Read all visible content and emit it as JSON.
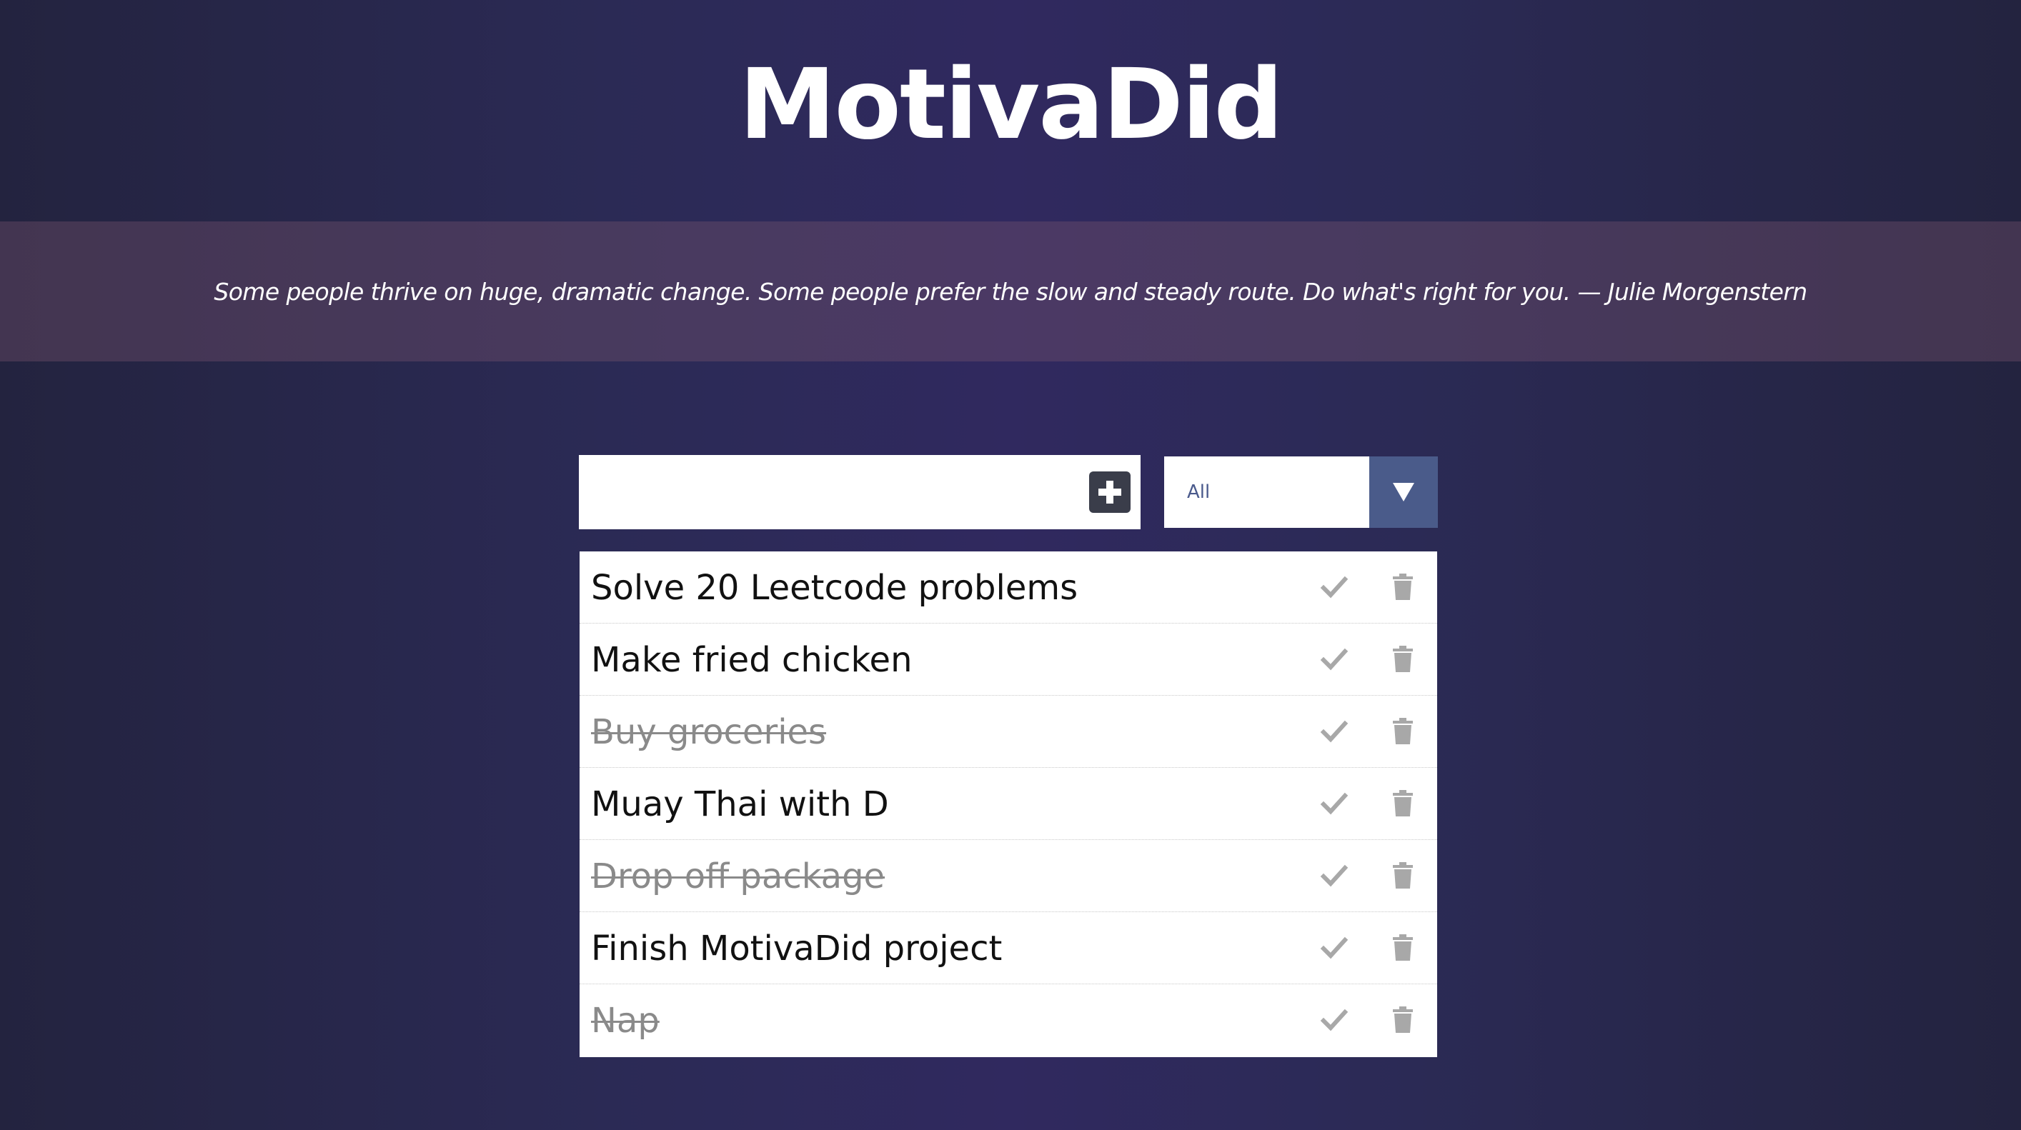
{
  "app": {
    "title": "MotivaDid"
  },
  "quote": {
    "text": "Some people thrive on huge, dramatic change. Some people prefer the slow and steady route. Do what's right for you. — Julie Morgenstern"
  },
  "form": {
    "input_value": "",
    "input_placeholder": "",
    "add_icon": "plus-square-icon",
    "filter_selected": "All",
    "filter_arrow_icon": "triangle-down-icon"
  },
  "todos": [
    {
      "text": "Solve 20 Leetcode problems",
      "completed": false
    },
    {
      "text": "Make fried chicken",
      "completed": false
    },
    {
      "text": "Buy groceries",
      "completed": true
    },
    {
      "text": "Muay Thai with D",
      "completed": false
    },
    {
      "text": "Drop off package",
      "completed": true
    },
    {
      "text": "Finish MotivaDid project",
      "completed": false
    },
    {
      "text": "Nap",
      "completed": true
    }
  ],
  "icons": {
    "complete": "check-icon",
    "delete": "trash-icon"
  },
  "colors": {
    "background": "#2b2a55",
    "quote_band": "#4a3f5e",
    "add_button": "#3a3d4a",
    "filter_arrow_bg": "#4a5b8a",
    "filter_text": "#4a5a8c",
    "icon_gray": "#a8a8a8",
    "completed_text": "#8a8a8a"
  }
}
